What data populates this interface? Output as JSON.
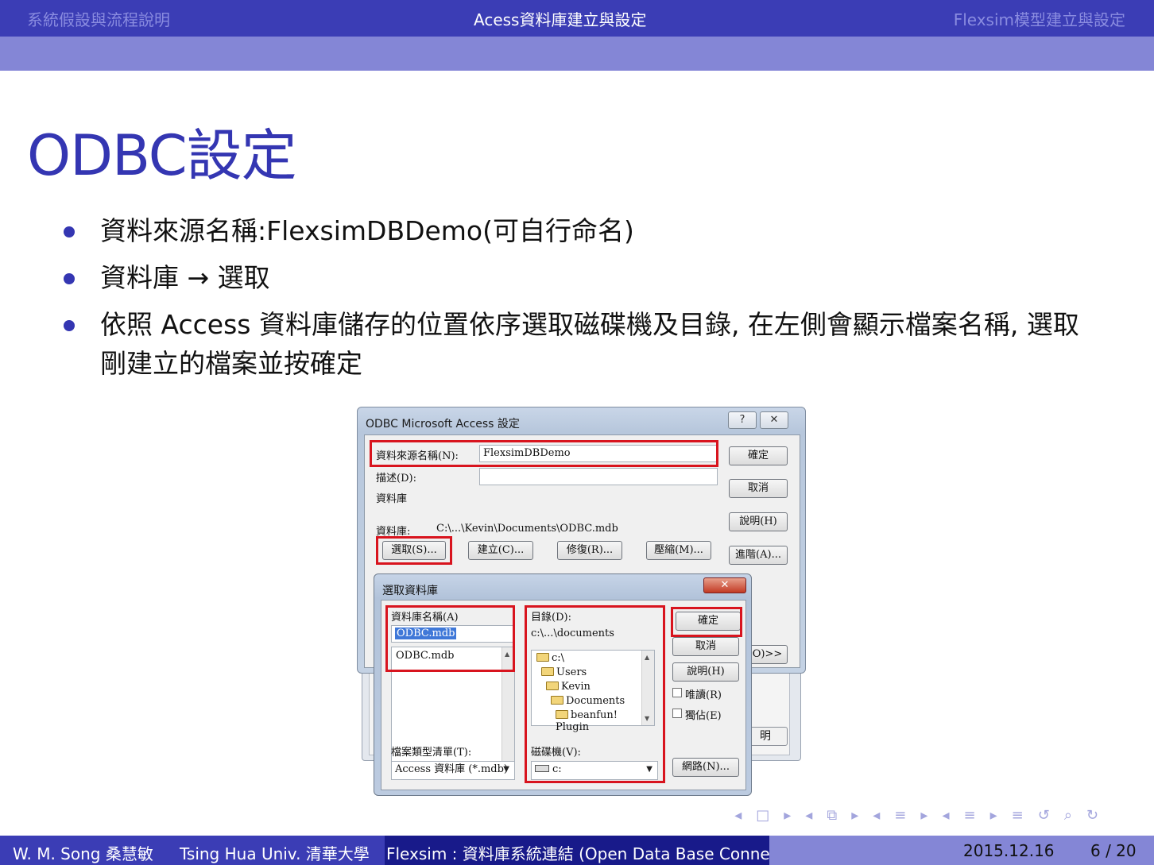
{
  "header": {
    "sections": [
      "系統假設與流程說明",
      "Acess資料庫建立與設定",
      "Flexsim模型建立與設定"
    ],
    "active_index": 1
  },
  "frame_title": "ODBC設定",
  "bullets": [
    "資料來源名稱:FlexsimDBDemo(可自行命名)",
    "資料庫 → 選取",
    "依照 Access 資料庫儲存的位置依序選取磁碟機及目錄, 在左側會顯示檔案名稱, 選取剛建立的檔案並按確定"
  ],
  "odbc_dialog": {
    "title": "ODBC Microsoft Access 設定",
    "help_btn": "?",
    "close_btn": "✕",
    "dsn_label": "資料來源名稱(N):",
    "dsn_value": "FlexsimDBDemo",
    "desc_label": "描述(D):",
    "desc_value": "",
    "db_group": "資料庫",
    "db_label": "資料庫:",
    "db_path": "C:\\...\\Kevin\\Documents\\ODBC.mdb",
    "buttons": {
      "select": "選取(S)...",
      "create": "建立(C)...",
      "repair": "修復(R)...",
      "compact": "壓縮(M)...",
      "ok": "確定",
      "cancel": "取消",
      "help": "說明(H)",
      "advanced": "進階(A)...",
      "options": "(O)>>",
      "ming": "明"
    }
  },
  "select_dialog": {
    "title": "選取資料庫",
    "close_btn": "✕",
    "dbname_label": "資料庫名稱(A)",
    "dbname_value": "ODBC.mdb",
    "file_list": [
      "ODBC.mdb"
    ],
    "dir_label": "目錄(D):",
    "dir_value": "c:\\...\\documents",
    "dir_tree": [
      "c:\\",
      "Users",
      "Kevin",
      "Documents",
      "beanfun! Plugin"
    ],
    "filetype_label": "檔案類型清單(T):",
    "filetype_value": "Access 資料庫 (*.mdb)",
    "drive_label": "磁碟機(V):",
    "drive_value": "c:",
    "ok": "確定",
    "cancel": "取消",
    "help": "說明(H)",
    "readonly": "唯讀(R)",
    "exclusive": "獨佔(E)",
    "network": "網路(N)..."
  },
  "nav_symbols": [
    "◂",
    "□",
    "▸",
    "◂",
    "⧉",
    "▸",
    "◂",
    "≡",
    "▸",
    "◂",
    "≡",
    "▸",
    "≡",
    "↺",
    "⌕",
    "↻"
  ],
  "footer": {
    "author": "W. M. Song 桑慧敏",
    "institute": "Tsing Hua Univ. 清華大學",
    "title": "Flexsim : 資料庫系統連結 (Open Data Base Conne",
    "date": "2015.12.16",
    "page": "6 / 20"
  }
}
